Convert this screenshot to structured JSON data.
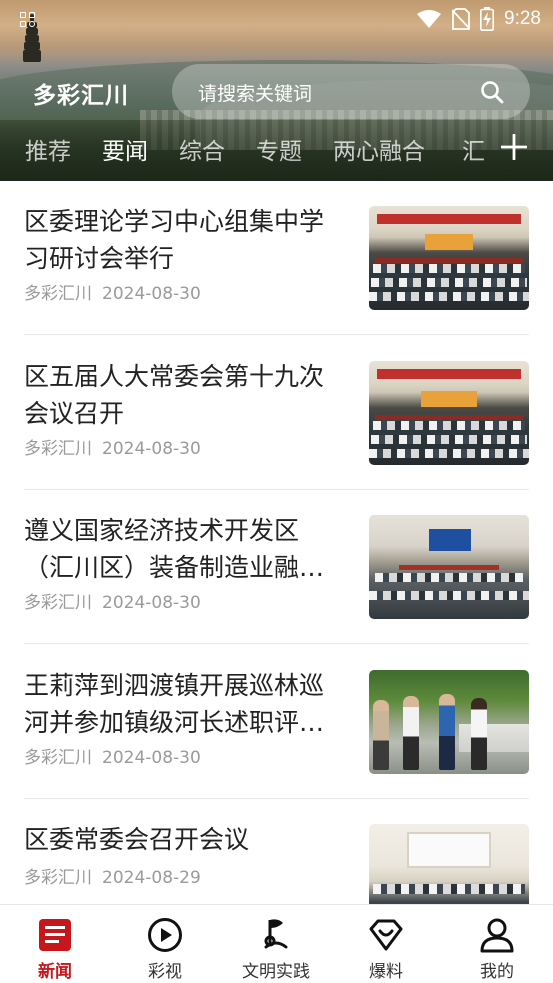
{
  "status_bar": {
    "time": "9:28"
  },
  "header": {
    "app_title": "多彩汇川",
    "search": {
      "placeholder": "请搜索关键词"
    }
  },
  "tabs": [
    {
      "label": "推荐",
      "active": false
    },
    {
      "label": "要闻",
      "active": true
    },
    {
      "label": "综合",
      "active": false
    },
    {
      "label": "专题",
      "active": false
    },
    {
      "label": "两心融合",
      "active": false
    },
    {
      "label": "汇",
      "active": false
    }
  ],
  "news": [
    {
      "title": "区委理论学习中心组集中学习研讨会举行",
      "source": "多彩汇川",
      "date": "2024-08-30",
      "thumb": "meeting-photo"
    },
    {
      "title": "区五届人大常委会第十九次会议召开",
      "source": "多彩汇川",
      "date": "2024-08-30",
      "thumb": "meeting-photo"
    },
    {
      "title": "遵义国家经济技术开发区（汇川区）装备制造业融入…",
      "source": "多彩汇川",
      "date": "2024-08-30",
      "thumb": "meeting-photo"
    },
    {
      "title": "王莉萍到泗渡镇开展巡林巡河并参加镇级河长述职评议…",
      "source": "多彩汇川",
      "date": "2024-08-30",
      "thumb": "outdoor-photo"
    },
    {
      "title": "区委常委会召开会议",
      "source": "多彩汇川",
      "date": "2024-08-29",
      "thumb": "meeting-room-photo"
    }
  ],
  "bottom_nav": [
    {
      "label": "新闻",
      "icon": "news-icon",
      "active": true
    },
    {
      "label": "彩视",
      "icon": "play-icon",
      "active": false
    },
    {
      "label": "文明实践",
      "icon": "flag-icon",
      "active": false
    },
    {
      "label": "爆料",
      "icon": "heart-diamond-icon",
      "active": false
    },
    {
      "label": "我的",
      "icon": "user-icon",
      "active": false
    }
  ],
  "colors": {
    "accent": "#c8161d",
    "text_primary": "#222222",
    "text_secondary": "#9a9a9a"
  }
}
